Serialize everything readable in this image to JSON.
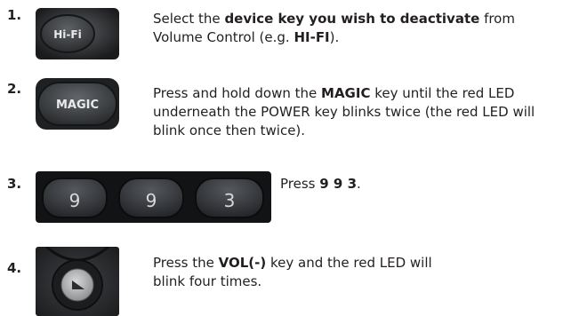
{
  "steps": [
    {
      "number": "1.",
      "key_label": "Hi-Fi",
      "text_parts": [
        "Select the ",
        "device key you wish to deactivate",
        " from Volume Control (e.g. ",
        "HI-FI",
        ")."
      ]
    },
    {
      "number": "2.",
      "key_label": "MAGIC",
      "text_parts": [
        "Press and hold down the ",
        "MAGIC",
        " key until the red LED underneath the POWER key blinks twice (the red LED will blink once then twice)."
      ]
    },
    {
      "number": "3.",
      "key_labels": [
        "9",
        "9",
        "3"
      ],
      "text_parts": [
        "Press ",
        "9 9 3",
        "."
      ]
    },
    {
      "number": "4.",
      "key_icon": "play-triangle-icon",
      "text_parts": [
        "Press the ",
        "VOL(-)",
        " key and the red LED will",
        "blink four times."
      ]
    }
  ]
}
